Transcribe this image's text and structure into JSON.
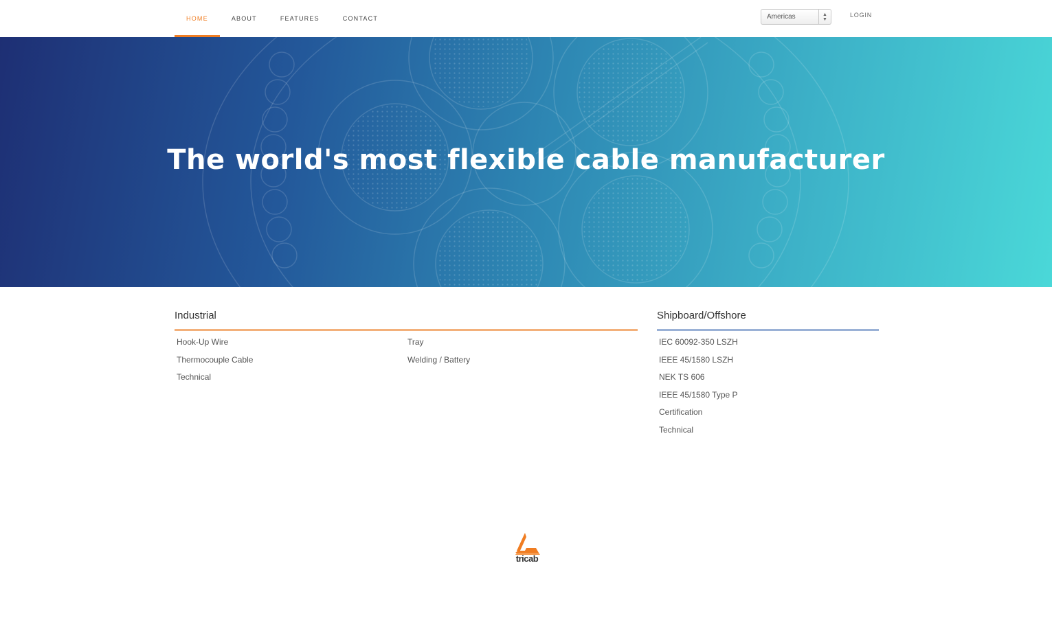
{
  "nav": {
    "items": [
      {
        "label": "HOME",
        "active": true
      },
      {
        "label": "ABOUT",
        "active": false
      },
      {
        "label": "FEATURES",
        "active": false
      },
      {
        "label": "CONTACT",
        "active": false
      }
    ],
    "region": {
      "selected": "Americas",
      "arrow_icon": "select-arrows-icon"
    },
    "login_label": "LOGIN"
  },
  "hero": {
    "title": "The world's most flexible cable manufacturer",
    "background_colors": [
      "#1e2f74",
      "#2e88b4",
      "#4ad8d8"
    ]
  },
  "sections": {
    "industrial": {
      "title": "Industrial",
      "accent": "#f3b07a",
      "links": [
        "Hook-Up Wire",
        "Tray",
        "Thermocouple Cable",
        "Welding / Battery",
        "Technical"
      ]
    },
    "shipboard": {
      "title": "Shipboard/Offshore",
      "accent": "#9ab1d6",
      "links": [
        "IEC 60092-350 LSZH",
        "IEEE 45/1580 LSZH",
        "NEK TS 606",
        "IEEE 45/1580 Type P",
        "Certification",
        "Technical"
      ]
    }
  },
  "footer": {
    "logo_text": "tricab",
    "logo_color": "#f07d22"
  },
  "colors": {
    "accent_orange": "#f07d22"
  }
}
